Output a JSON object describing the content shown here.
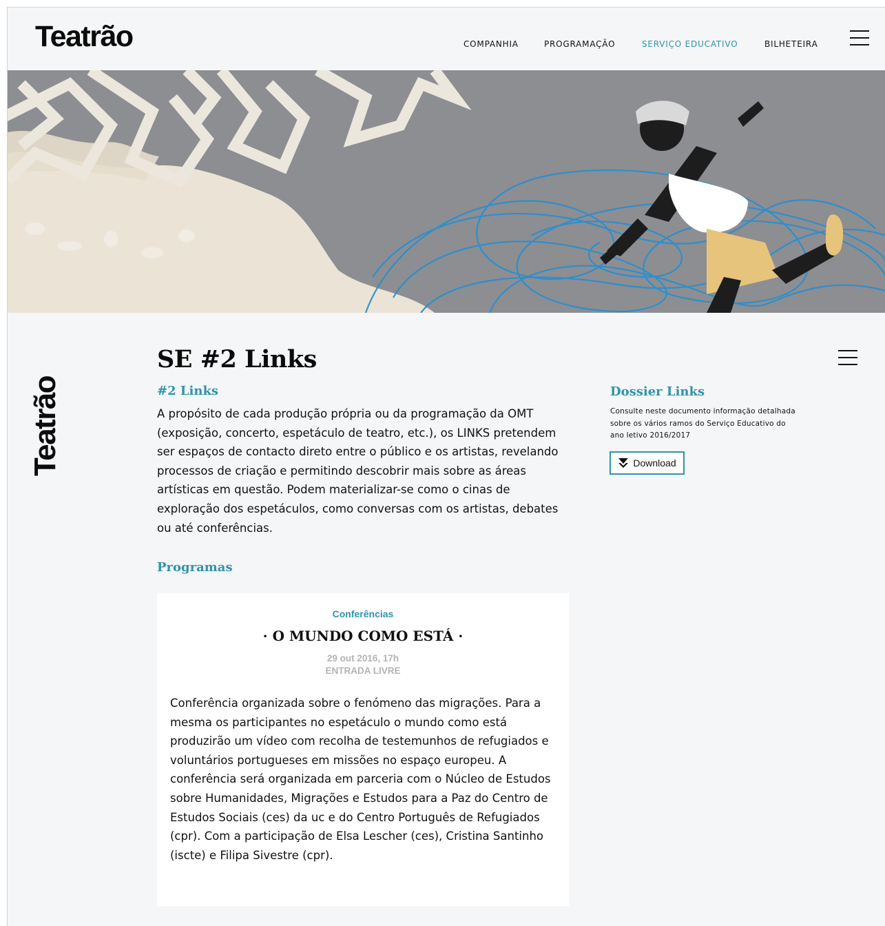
{
  "header": {
    "logo": "Teatrão",
    "nav": [
      {
        "label": "COMPANHIA",
        "active": false
      },
      {
        "label": "PROGRAMAÇÃO",
        "active": false
      },
      {
        "label": "SERVIÇO EDUCATIVO",
        "active": true
      },
      {
        "label": "BILHETEIRA",
        "active": false
      }
    ]
  },
  "sidebar": {
    "vertical_logo": "Teatrão"
  },
  "main": {
    "title": "SE #2 Links",
    "subtitle": "#2 Links",
    "intro": "A propósito de cada produção própria ou da programação da OMT (exposição, concerto, espetáculo de teatro, etc.), os LINKS pretendem ser espaços de contacto direto entre o público e os artistas, revelando processos de criação e permitindo descobrir mais sobre as áreas artísticas em questão. Podem materializar-se como o cinas de exploração dos espetáculos, como conversas com os artistas, debates ou até conferências.",
    "programs_heading": "Programas"
  },
  "dossier": {
    "heading": "Dossier Links",
    "text": "Consulte neste documento informação detalhada sobre os vários ramos do Serviço Educativo do ano letivo 2016/2017",
    "download_label": "Download"
  },
  "program_card": {
    "category": "Conferências",
    "title": "· O MUNDO COMO ESTÁ ·",
    "date": "29 out 2016, 17h",
    "entry": "ENTRADA LIVRE",
    "body": "Conferência organizada sobre o fenómeno das migrações. Para a mesma os participantes no espetáculo o mundo como está produzirão um vídeo com recolha de testemunhos de refugiados e voluntários portugueses em missões no espaço europeu. A conferência será organizada em parceria com o Núcleo de Estudos sobre Humanidades, Migrações e Estudos para a Paz do Centro de Estudos Sociais (ces) da uc e do Centro Português de Refugiados (cpr). Com a participação de Elsa Lescher (ces), Cristina Santinho (iscte) e Filipa Sivestre (cpr)."
  },
  "colors": {
    "accent": "#2f93ad",
    "page_bg": "#f4f6f7",
    "text": "#111111",
    "muted": "#b3b3b3",
    "hero_gray": "#8c8e92",
    "hero_blue": "#2a8fd0",
    "hero_cream": "#ebe4d6"
  },
  "icons": {
    "menu": "hamburger-menu-icon",
    "download": "download-chevron-icon"
  }
}
